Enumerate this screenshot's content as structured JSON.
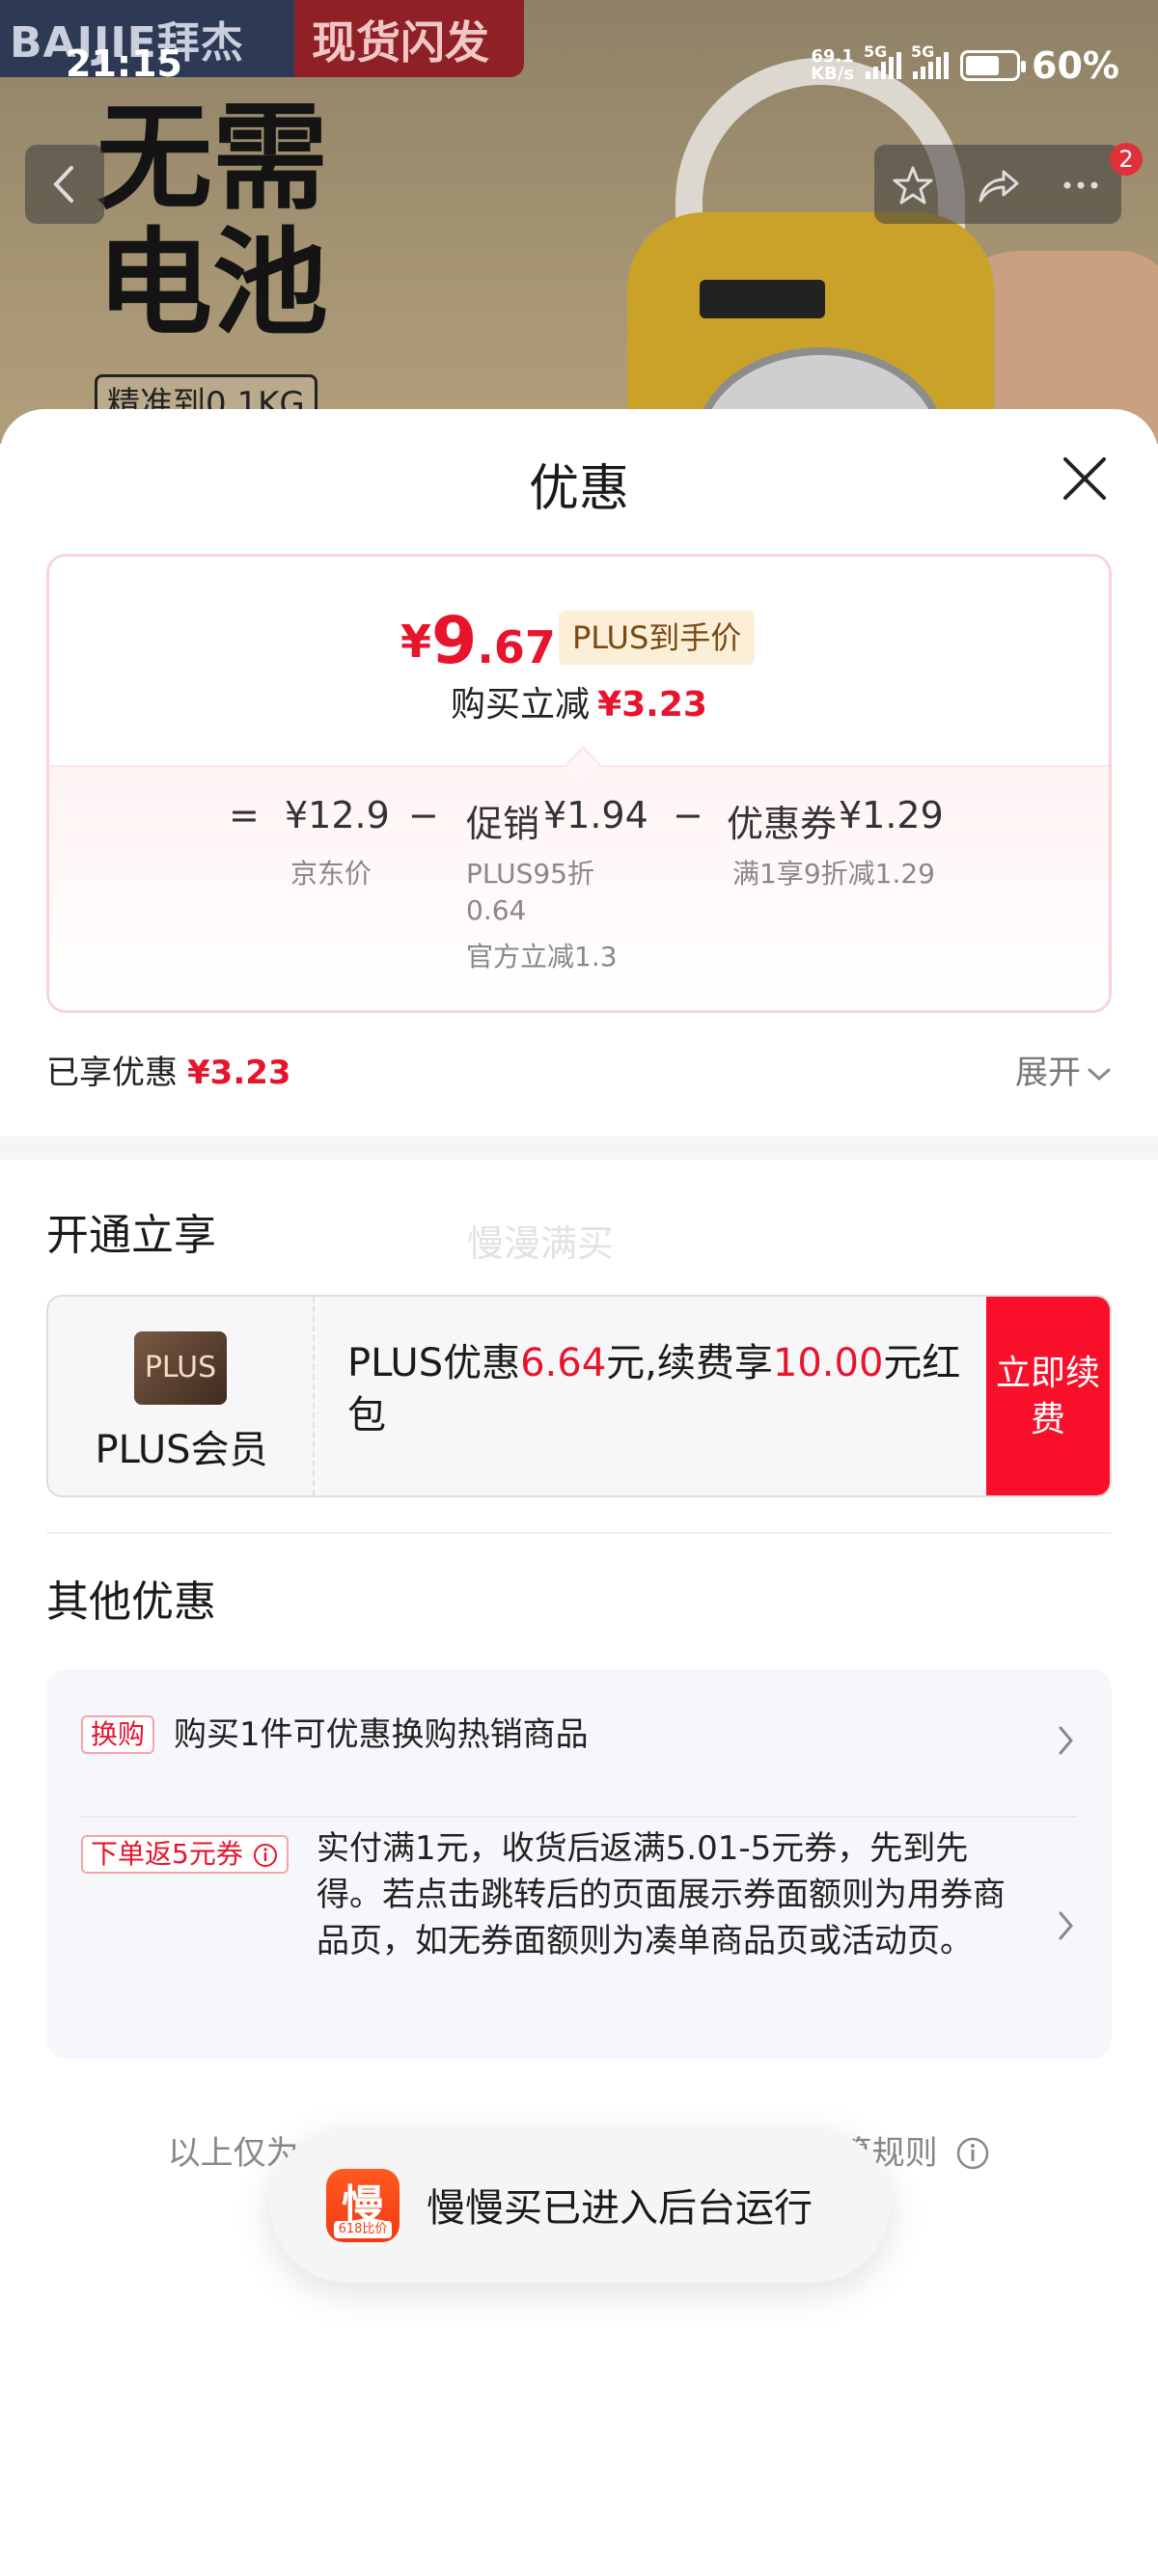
{
  "status_bar": {
    "time": "21:15",
    "net_speed_value": "69.1",
    "net_speed_unit": "KB/s",
    "sim1": "5G",
    "sim2": "5G",
    "battery": "60%"
  },
  "background_page": {
    "brand": "BAIJIE拜杰",
    "spot_tag": "现货闪发",
    "headline_line1": "无需",
    "headline_line2": "电池",
    "precision_label": "精准到0.1KG",
    "cart_badge_count": "2"
  },
  "sheet": {
    "title": "优惠",
    "price_card": {
      "currency": "¥",
      "final_integer": "9",
      "final_decimal": ".67",
      "plus_label": "PLUS到手价",
      "instant_cut_label": "购买立减",
      "instant_cut_amount": "¥3.23",
      "equals": "=",
      "minus": "−",
      "jd_price": "¥12.9",
      "jd_price_label": "京东价",
      "promo_label": "促销",
      "promo_amount": "¥1.94",
      "promo_detail_1": "PLUS95折",
      "promo_detail_2": "0.64",
      "promo_detail_3": "官方立减1.3",
      "coupon_label": "优惠券",
      "coupon_amount": "¥1.29",
      "coupon_detail": "满1享9折减1.29"
    },
    "enjoyed_label": "已享优惠",
    "enjoyed_amount": "¥3.23",
    "expand_label": "展开",
    "open_section_title": "开通立享",
    "watermark": "慢漫满买",
    "plus_card": {
      "logo_text": "PLUS",
      "name": "PLUS会员",
      "desc_prefix": "PLUS优惠",
      "desc_amount1": "6.64",
      "desc_mid": "元,续费享",
      "desc_amount2": "10.00",
      "desc_suffix": "元红包",
      "button": "立即续费"
    },
    "other_section_title": "其他优惠",
    "other_offers": [
      {
        "tag": "换购",
        "text": "购买1件可优惠换购热销商品"
      },
      {
        "tag": "下单返5元券",
        "text": "实付满1元，收货后返满5.01-5元券，先到先得。若点击跳转后的页面展示券面额则为用券商品页，如无券面额则为凑单商品页或活动页。"
      }
    ],
    "footer_left": "以上仅为",
    "footer_right": "算规则"
  },
  "toast": {
    "icon_glyph": "慢",
    "icon_sub": "618比价",
    "text": "慢慢买已进入后台运行"
  },
  "colors": {
    "accent_red": "#e8142c",
    "plus_gold_bg": "#fcefd7",
    "renew_button": "#f8102a"
  }
}
